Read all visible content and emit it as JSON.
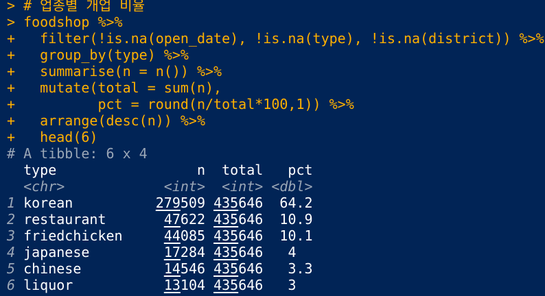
{
  "console": {
    "prompt_main": ">",
    "prompt_cont": "+",
    "code_lines": [
      {
        "prompt": ">",
        "text": " # 업종별 개업 비율"
      },
      {
        "prompt": ">",
        "text": " foodshop %>%"
      },
      {
        "prompt": "+",
        "text": "   filter(!is.na(open_date), !is.na(type), !is.na(district)) %>%"
      },
      {
        "prompt": "+",
        "text": "   group_by(type) %>%"
      },
      {
        "prompt": "+",
        "text": "   summarise(n = n()) %>%"
      },
      {
        "prompt": "+",
        "text": "   mutate(total = sum(n),"
      },
      {
        "prompt": "+",
        "text": "          pct = round(n/total*100,1)) %>%"
      },
      {
        "prompt": "+",
        "text": "   arrange(desc(n)) %>%"
      },
      {
        "prompt": "+",
        "text": "   head(6)"
      }
    ],
    "tibble": {
      "comment": "# A tibble: 6 x 4",
      "columns": [
        {
          "name": "type",
          "kind": "<chr>"
        },
        {
          "name": "n",
          "kind": "<int>"
        },
        {
          "name": "total",
          "kind": "<int>"
        },
        {
          "name": "pct",
          "kind": "<dbl>"
        }
      ],
      "rows": [
        {
          "idx": "1",
          "type": "korean",
          "n_hi": "279",
          "n_lo": "509",
          "total_hi": "435",
          "total_lo": "646",
          "pct": "64.2"
        },
        {
          "idx": "2",
          "type": "restaurant",
          "n_hi": "47",
          "n_lo": "622",
          "total_hi": "435",
          "total_lo": "646",
          "pct": "10.9"
        },
        {
          "idx": "3",
          "type": "friedchicken",
          "n_hi": "44",
          "n_lo": "085",
          "total_hi": "435",
          "total_lo": "646",
          "pct": "10.1"
        },
        {
          "idx": "4",
          "type": "japanese",
          "n_hi": "17",
          "n_lo": "284",
          "total_hi": "435",
          "total_lo": "646",
          "pct": "4"
        },
        {
          "idx": "5",
          "type": "chinese",
          "n_hi": "14",
          "n_lo": "546",
          "total_hi": "435",
          "total_lo": "646",
          "pct": "3.3"
        },
        {
          "idx": "6",
          "type": "liquor",
          "n_hi": "13",
          "n_lo": "104",
          "total_hi": "435",
          "total_lo": "646",
          "pct": "3"
        }
      ]
    }
  },
  "colors": {
    "background": "#012456",
    "code": "#ffb000",
    "output": "#ffffff",
    "meta": "#9aa6b6"
  }
}
